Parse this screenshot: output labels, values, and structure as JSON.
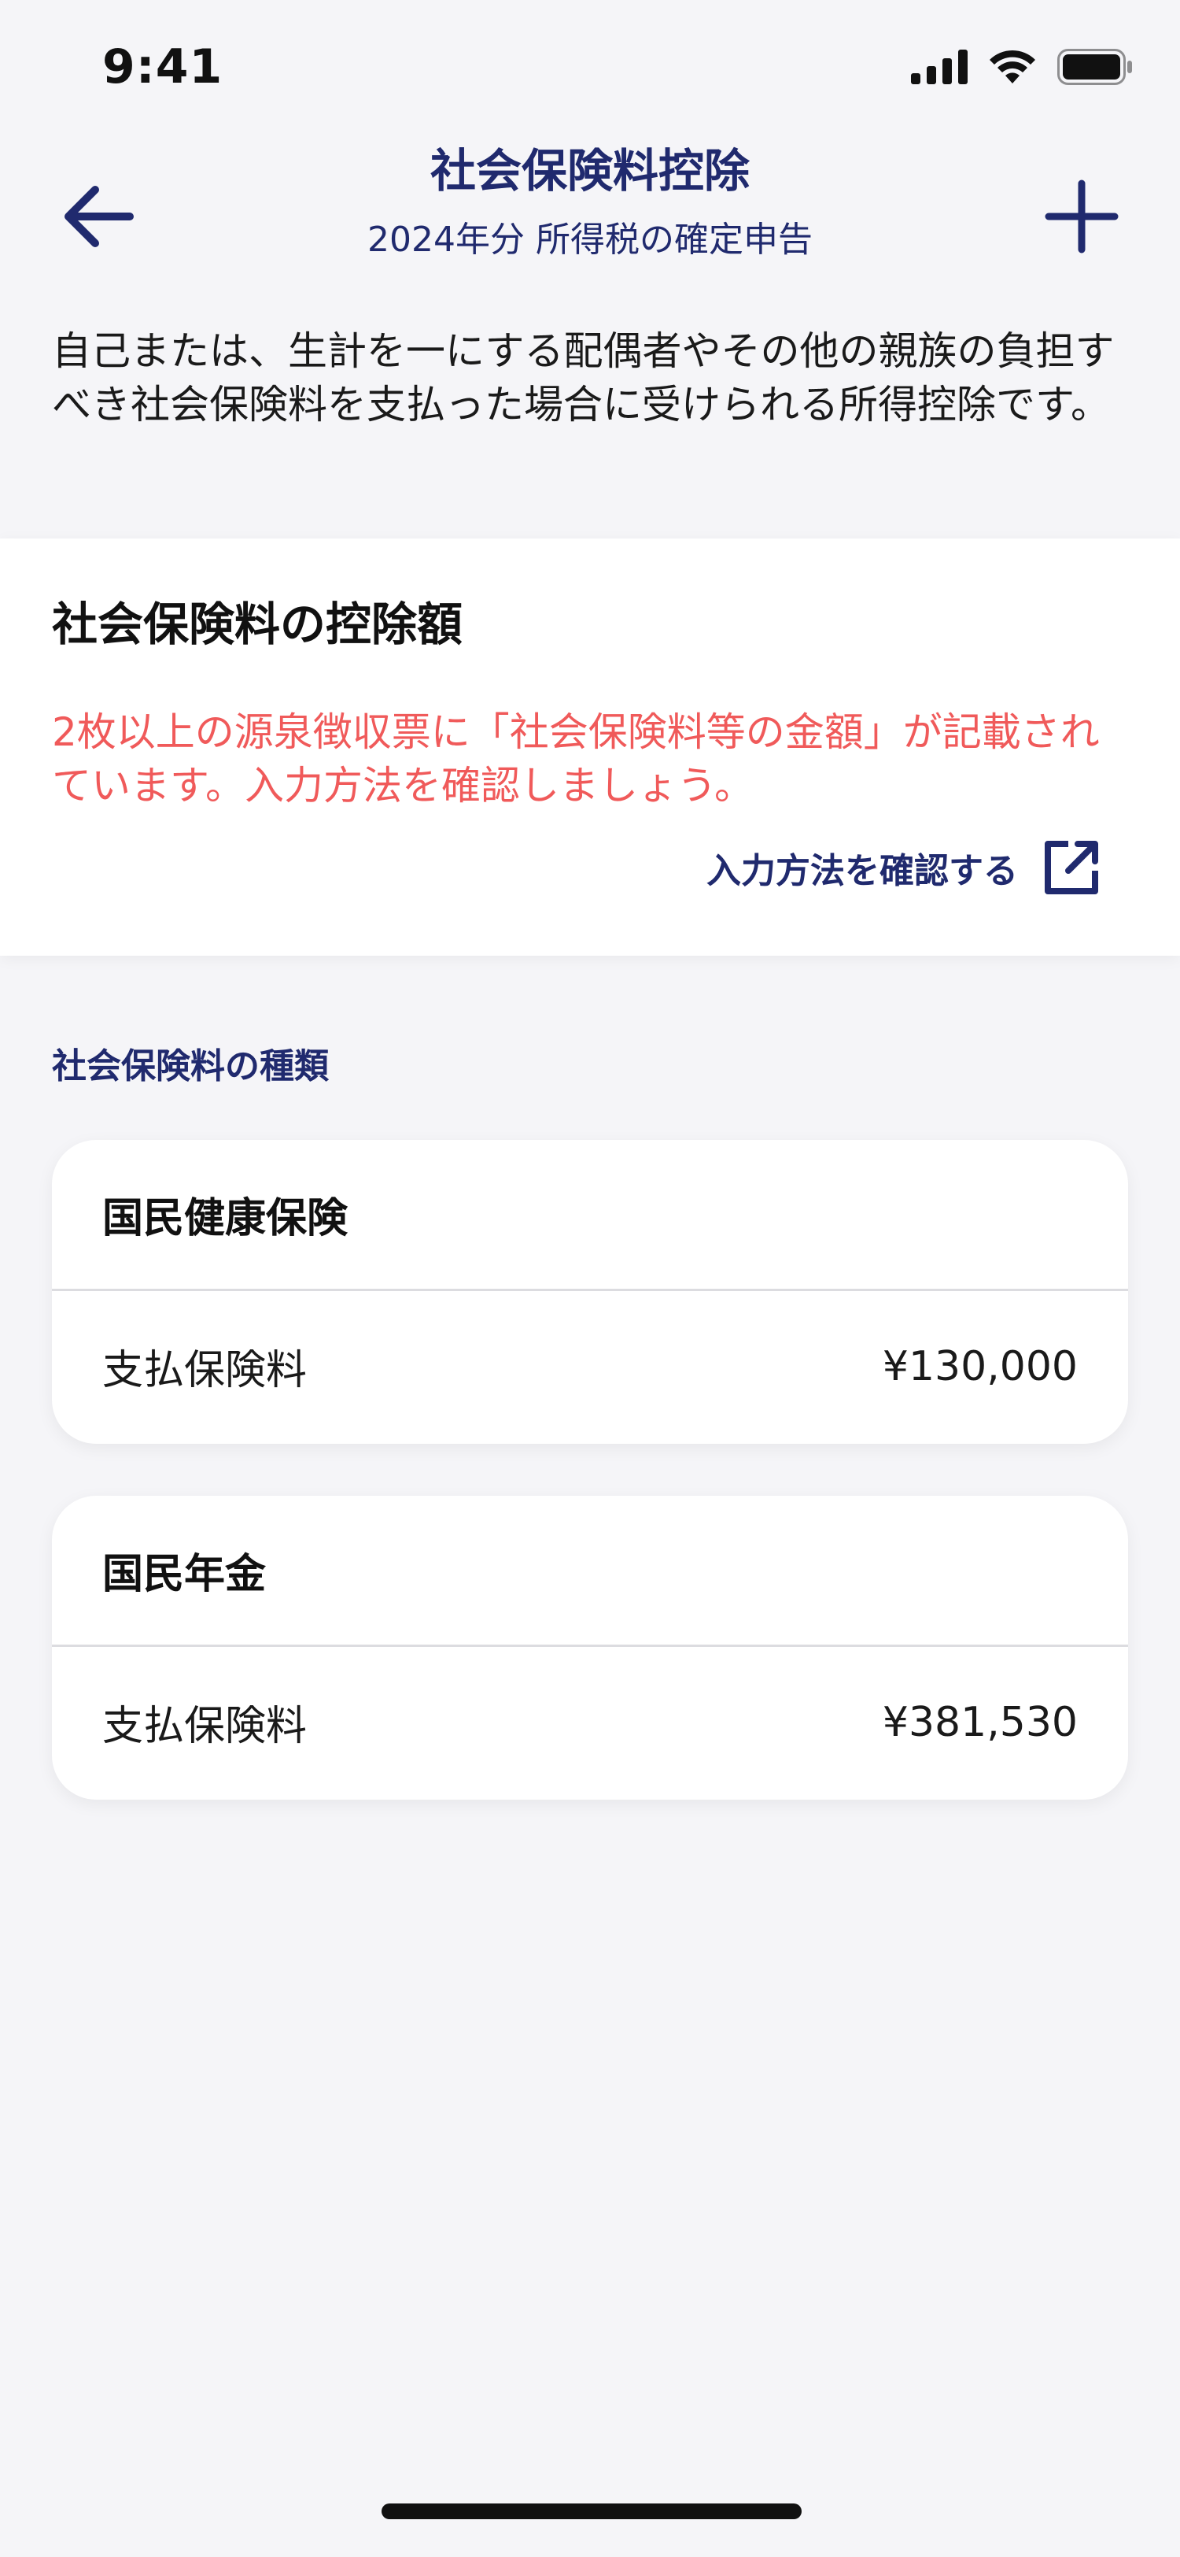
{
  "status_bar": {
    "time": "9:41",
    "icons": [
      "signal-icon",
      "wifi-icon",
      "battery-icon"
    ]
  },
  "nav": {
    "title": "社会保険料控除",
    "subtitle": "2024年分 所得税の確定申告",
    "back_icon": "arrow-left-icon",
    "add_icon": "plus-icon"
  },
  "description": "自己または、生計を一にする配偶者やその他の親族の負担すべき社会保険料を支払った場合に受けられる所得控除です。",
  "deduction": {
    "title": "社会保険料の控除額",
    "warning": "2枚以上の源泉徴収票に「社会保険料等の金額」が記載されています。入力方法を確認しましょう。",
    "link_label": "入力方法を確認する",
    "link_icon": "external-link-icon"
  },
  "types_section": {
    "heading": "社会保険料の種類",
    "items": [
      {
        "name": "国民健康保険",
        "label": "支払保険料",
        "amount": "¥130,000"
      },
      {
        "name": "国民年金",
        "label": "支払保険料",
        "amount": "¥381,530"
      }
    ]
  },
  "colors": {
    "accent": "#202a6e",
    "warning": "#f05a5a",
    "background": "#f5f5f8",
    "card": "#ffffff"
  }
}
